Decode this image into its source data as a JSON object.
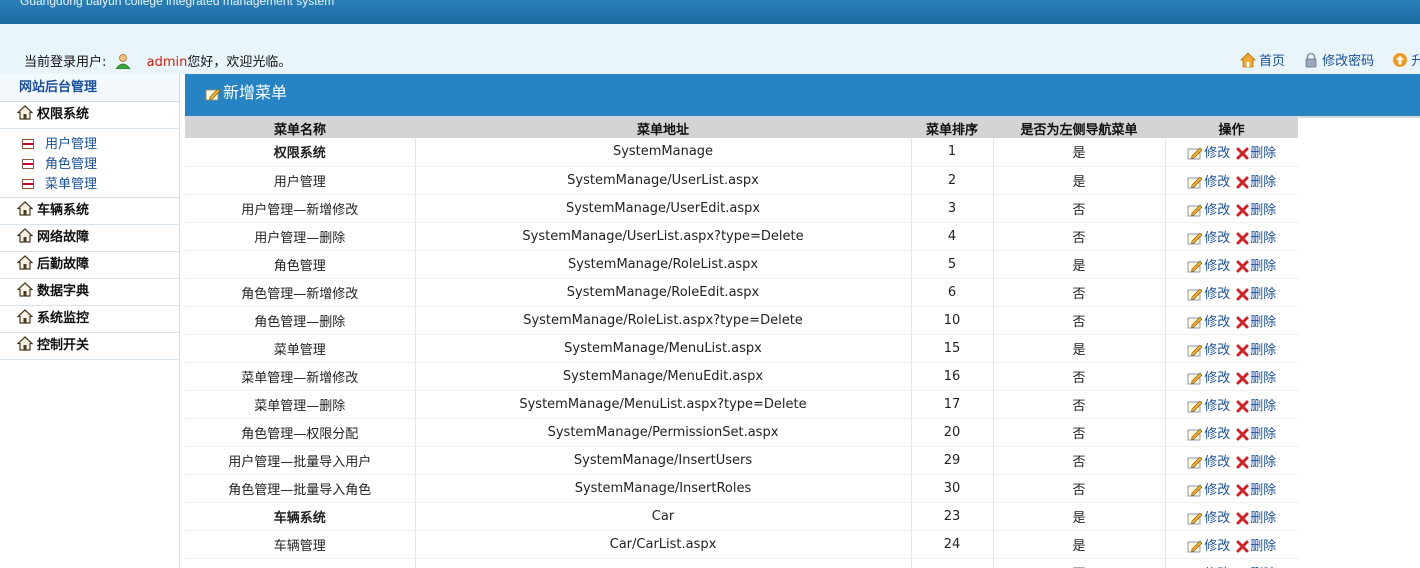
{
  "header": {
    "subtitle": "Guangdong baiyun college integrated management system"
  },
  "userbar": {
    "current_user_label": "当前登录用户:",
    "username": "admin",
    "greeting": "您好，欢迎光临。",
    "links": [
      {
        "label": "首页",
        "icon": "home-icon"
      },
      {
        "label": "修改密码",
        "icon": "lock-icon"
      },
      {
        "label": "升级",
        "icon": "upgrade-icon"
      }
    ]
  },
  "sidebar": {
    "title": "网站后台管理",
    "groups": [
      {
        "label": "权限系统",
        "icon": "house-icon",
        "items": [
          "用户管理",
          "角色管理",
          "菜单管理"
        ]
      },
      {
        "label": "车辆系统",
        "icon": "house-icon"
      },
      {
        "label": "网络故障",
        "icon": "house-icon"
      },
      {
        "label": "后勤故障",
        "icon": "house-icon"
      },
      {
        "label": "数据字典",
        "icon": "house-icon"
      },
      {
        "label": "系统监控",
        "icon": "house-icon"
      },
      {
        "label": "控制开关",
        "icon": "house-icon"
      }
    ]
  },
  "main": {
    "title": "新增菜单",
    "table": {
      "headers": [
        "菜单名称",
        "菜单地址",
        "菜单排序",
        "是否为左侧导航菜单",
        "操作"
      ],
      "edit_label": "修改",
      "delete_label": "删除",
      "rows": [
        {
          "name": "权限系统",
          "url": "SystemManage",
          "order": "1",
          "nav": "是",
          "bold": true
        },
        {
          "name": "用户管理",
          "url": "SystemManage/UserList.aspx",
          "order": "2",
          "nav": "是"
        },
        {
          "name": "用户管理—新增修改",
          "url": "SystemManage/UserEdit.aspx",
          "order": "3",
          "nav": "否"
        },
        {
          "name": "用户管理—删除",
          "url": "SystemManage/UserList.aspx?type=Delete",
          "order": "4",
          "nav": "否"
        },
        {
          "name": "角色管理",
          "url": "SystemManage/RoleList.aspx",
          "order": "5",
          "nav": "是"
        },
        {
          "name": "角色管理—新增修改",
          "url": "SystemManage/RoleEdit.aspx",
          "order": "6",
          "nav": "否"
        },
        {
          "name": "角色管理—删除",
          "url": "SystemManage/RoleList.aspx?type=Delete",
          "order": "10",
          "nav": "否"
        },
        {
          "name": "菜单管理",
          "url": "SystemManage/MenuList.aspx",
          "order": "15",
          "nav": "是"
        },
        {
          "name": "菜单管理—新增修改",
          "url": "SystemManage/MenuEdit.aspx",
          "order": "16",
          "nav": "否"
        },
        {
          "name": "菜单管理—删除",
          "url": "SystemManage/MenuList.aspx?type=Delete",
          "order": "17",
          "nav": "否"
        },
        {
          "name": "角色管理—权限分配",
          "url": "SystemManage/PermissionSet.aspx",
          "order": "20",
          "nav": "否"
        },
        {
          "name": "用户管理—批量导入用户",
          "url": "SystemManage/InsertUsers",
          "order": "29",
          "nav": "否"
        },
        {
          "name": "角色管理—批量导入角色",
          "url": "SystemManage/InsertRoles",
          "order": "30",
          "nav": "否"
        },
        {
          "name": "车辆系统",
          "url": "Car",
          "order": "23",
          "nav": "是",
          "bold": true
        },
        {
          "name": "车辆管理",
          "url": "Car/CarList.aspx",
          "order": "24",
          "nav": "是"
        },
        {
          "name": "",
          "url": "",
          "order": "",
          "nav": "否"
        }
      ]
    }
  }
}
